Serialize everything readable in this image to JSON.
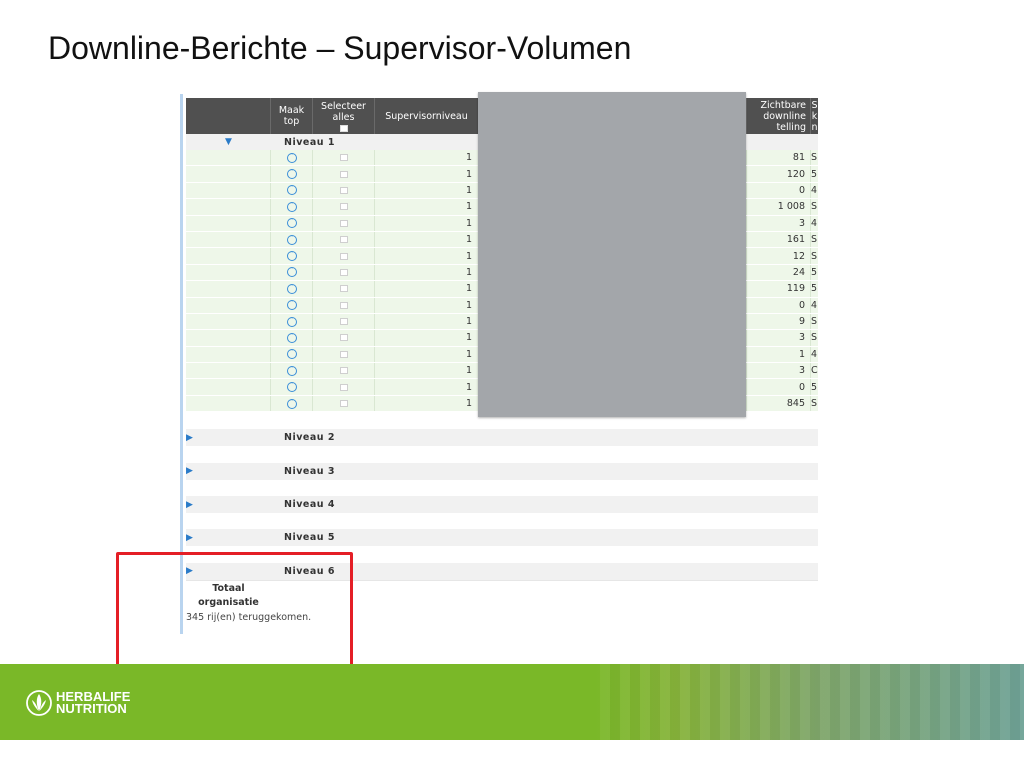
{
  "slide": {
    "title": "Downline-Berichte – Supervisor-Volumen"
  },
  "table": {
    "headers": {
      "top": "Maak top",
      "select_all": "Selecteer alles",
      "level": "Supervisorniveau",
      "downline": "Zichtbare downline telling",
      "extra": "S k n"
    },
    "niveau1": "Niveau 1",
    "rows": [
      {
        "level": "1",
        "count": "81",
        "extra": "S"
      },
      {
        "level": "1",
        "count": "120",
        "extra": "5"
      },
      {
        "level": "1",
        "count": "0",
        "extra": "4"
      },
      {
        "level": "1",
        "count": "1 008",
        "extra": "S"
      },
      {
        "level": "1",
        "count": "3",
        "extra": "4"
      },
      {
        "level": "1",
        "count": "161",
        "extra": "S"
      },
      {
        "level": "1",
        "count": "12",
        "extra": "S"
      },
      {
        "level": "1",
        "count": "24",
        "extra": "5"
      },
      {
        "level": "1",
        "count": "119",
        "extra": "5"
      },
      {
        "level": "1",
        "count": "0",
        "extra": "4"
      },
      {
        "level": "1",
        "count": "9",
        "extra": "S"
      },
      {
        "level": "1",
        "count": "3",
        "extra": "S"
      },
      {
        "level": "1",
        "count": "1",
        "extra": "4"
      },
      {
        "level": "1",
        "count": "3",
        "extra": "C"
      },
      {
        "level": "1",
        "count": "0",
        "extra": "5"
      },
      {
        "level": "1",
        "count": "845",
        "extra": "S"
      }
    ],
    "groups": [
      "Niveau 2",
      "Niveau 3",
      "Niveau 4",
      "Niveau 5",
      "Niveau 6"
    ],
    "total": "Totaal organisatie",
    "rows_note": "345 rij(en) teruggekomen."
  },
  "footer": {
    "logo_line1": "HERBALIFE",
    "logo_line2": "NUTRITION"
  },
  "colors": {
    "highlight": "#e41e26",
    "brand_green": "#7ab828",
    "header_bg": "#505050"
  },
  "icons": {
    "expanded": "triangle-down-icon",
    "collapsed": "triangle-right-icon",
    "make_top": "chevron-up-circle-icon",
    "logo": "herbalife-leaf-icon"
  }
}
